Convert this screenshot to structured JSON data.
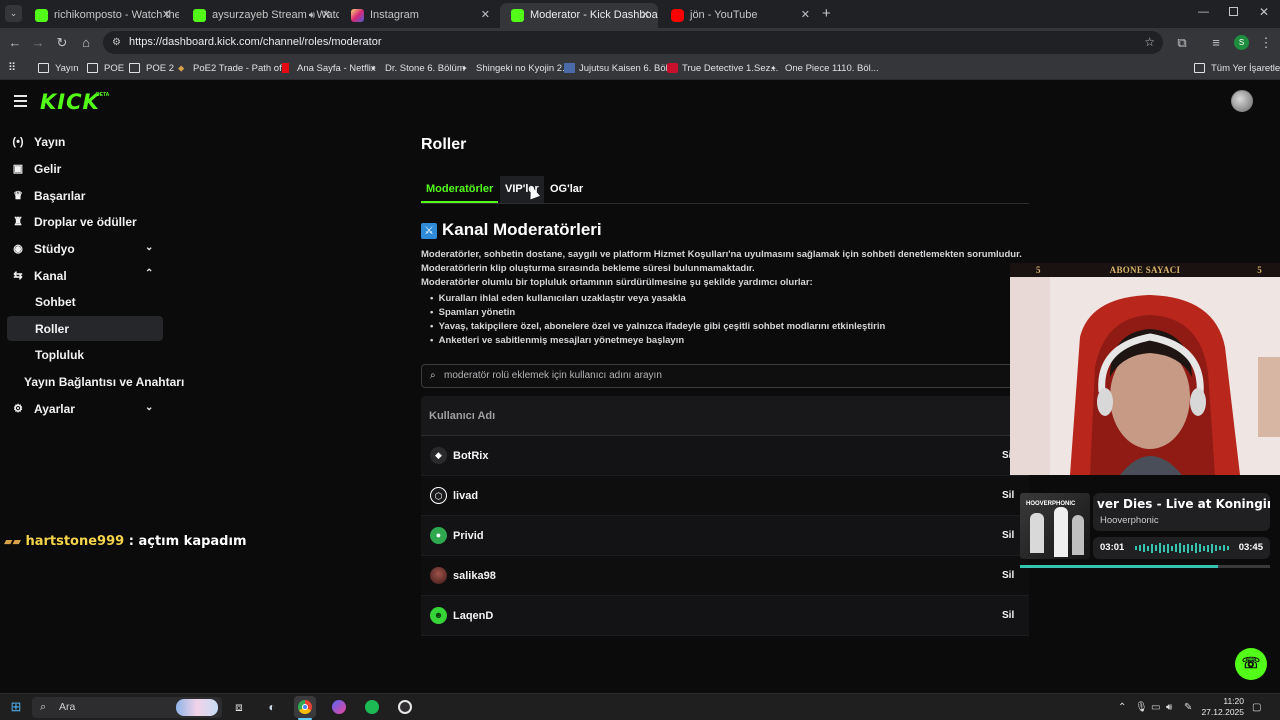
{
  "browser": {
    "tabs": [
      {
        "title": "richikomposto - Watch the VOD",
        "fav_color": "#53fc18"
      },
      {
        "title": "aysurzayeb Stream - Watch",
        "fav_color": "#53fc18",
        "audio_icon": "speaker-icon"
      },
      {
        "title": "Instagram",
        "fav_color": "#e1306c"
      },
      {
        "title": "Moderator - Kick Dashboard",
        "fav_color": "#53fc18"
      },
      {
        "title": "jön - YouTube",
        "fav_color": "#ff0000"
      }
    ],
    "new_tab": "+",
    "url": "https://dashboard.kick.com/channel/roles/moderator",
    "bookmarks": [
      "Yayın",
      "POE",
      "POE 2",
      "PoE2 Trade - Path of...",
      "Ana Sayfa - Netflix",
      "Dr. Stone 6. Bölüm",
      "Shingeki no Kyojin 2...",
      "Jujutsu Kaisen 6. Böl...",
      "True Detective 1.Sez...",
      "One Piece 1110. Böl..."
    ],
    "all_bookmarks": "Tüm Yer İşaretleri",
    "profile_initial": "S"
  },
  "kick": {
    "logo": "KICK",
    "beta": "BETA",
    "sidebar": [
      {
        "label": "Yayın",
        "icon": "broadcast-icon"
      },
      {
        "label": "Gelir",
        "icon": "revenue-icon"
      },
      {
        "label": "Başarılar",
        "icon": "trophy-icon"
      },
      {
        "label": "Droplar ve ödüller",
        "icon": "drops-icon"
      },
      {
        "label": "Stüdyo",
        "icon": "studio-icon"
      },
      {
        "label": "Kanal",
        "icon": "channel-icon"
      },
      {
        "label": "Sohbet"
      },
      {
        "label": "Roller"
      },
      {
        "label": "Topluluk"
      },
      {
        "label": "Yayın Bağlantısı ve Anahtarı"
      },
      {
        "label": "Ayarlar",
        "icon": "settings-icon"
      }
    ],
    "page_title": "Roller",
    "tabs": [
      "Moderatörler",
      "VIP'ler",
      "OG'lar"
    ],
    "active_tab": "Moderatörler",
    "section_title": "Kanal Moderatörleri",
    "desc_lines": [
      "Moderatörler, sohbetin dostane, saygılı ve platform Hizmet Koşulları'na uyulmasını sağlamak için sohbeti denetlemekten sorumludur.",
      "Moderatörlerin klip oluşturma sırasında bekleme süresi bulunmamaktadır.",
      "Moderatörler olumlu bir topluluk ortamının sürdürülmesine şu şekilde yardımcı olurlar:"
    ],
    "bullets": [
      "Kuralları ihlal eden kullanıcıları uzaklaştır veya yasakla",
      "Spamları yönetin",
      "Yavaş, takipçilere özel, abonelere özel ve yalnızca ifadeyle gibi çeşitli sohbet modlarını etkinleştirin",
      "Anketleri ve sabitlenmiş mesajları yönetmeye başlayın"
    ],
    "search_placeholder": "moderatör rolü eklemek için kullanıcı adını arayın",
    "table_header": "Kullanıcı Adı",
    "moderators": [
      {
        "name": "BotRix",
        "action": "Sil"
      },
      {
        "name": "livad",
        "action": "Sil"
      },
      {
        "name": "Privid",
        "action": "Sil"
      },
      {
        "name": "salika98",
        "action": "Sil"
      },
      {
        "name": "LaqenD",
        "action": "Sil"
      }
    ]
  },
  "overlay": {
    "chat_user": "hartstone999",
    "chat_message": ": açtım kapadım",
    "sub_counter_label": "ABONE SAYACI",
    "sub_counter_left": "5",
    "sub_counter_right": "5",
    "song_title": "ver Dies - Live at Koningin Elis",
    "song_artist": "Hooverphonic",
    "album_text": "HOOVERPHONIC",
    "time_elapsed": "03:01",
    "time_total": "03:45",
    "progress": 0.79
  },
  "taskbar": {
    "search": "Ara",
    "time": "11:20",
    "date": "27.12.2025"
  }
}
